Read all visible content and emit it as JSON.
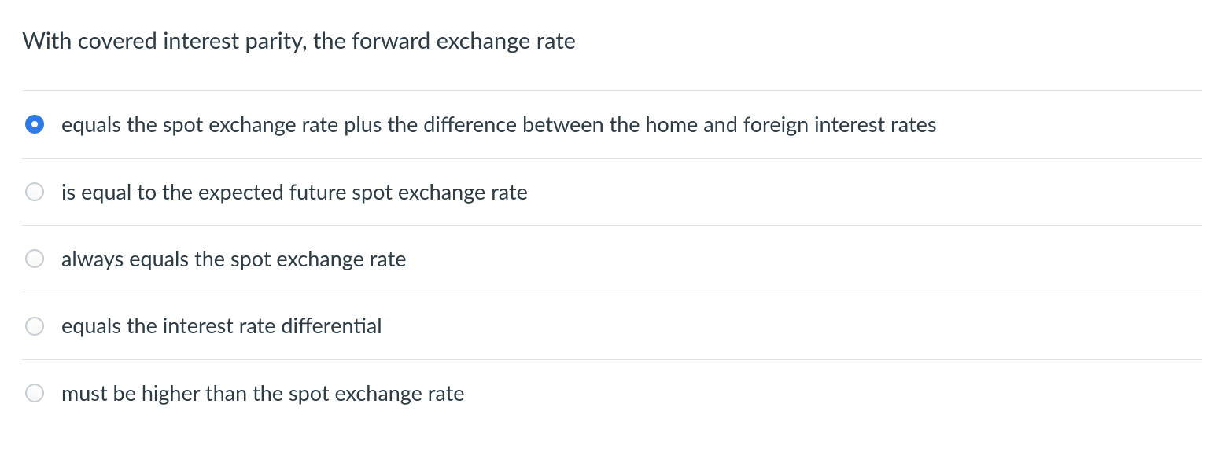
{
  "question": {
    "text": "With covered interest parity, the forward exchange rate",
    "selected_index": 0,
    "options": [
      {
        "label": "equals the spot exchange rate plus the difference between the home and foreign interest rates"
      },
      {
        "label": "is equal to the expected future spot exchange rate"
      },
      {
        "label": "always equals the spot exchange rate"
      },
      {
        "label": "equals the interest rate differential"
      },
      {
        "label": "must be higher than the spot exchange rate"
      }
    ]
  }
}
